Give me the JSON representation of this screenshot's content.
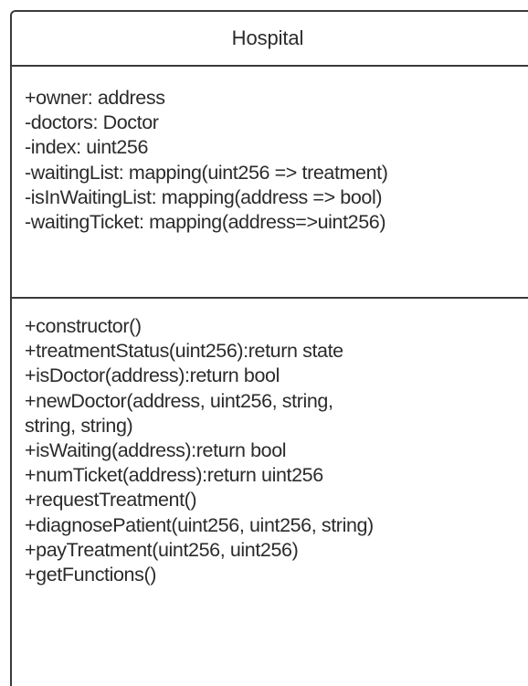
{
  "class": {
    "name": "Hospital",
    "attributes": [
      "+owner: address",
      "-doctors: Doctor",
      "-index: uint256",
      "-waitingList: mapping(uint256 => treatment)",
      "-isInWaitingList: mapping(address => bool)",
      "-waitingTicket: mapping(address=>uint256)"
    ],
    "operations": [
      "+constructor()",
      "+treatmentStatus(uint256):return state",
      "+isDoctor(address):return bool",
      "+newDoctor(address, uint256, string,",
      "string, string)",
      "+isWaiting(address):return bool",
      "+numTicket(address):return uint256",
      "+requestTreatment()",
      "+diagnosePatient(uint256, uint256, string)",
      "+payTreatment(uint256, uint256)",
      "+getFunctions()"
    ]
  }
}
